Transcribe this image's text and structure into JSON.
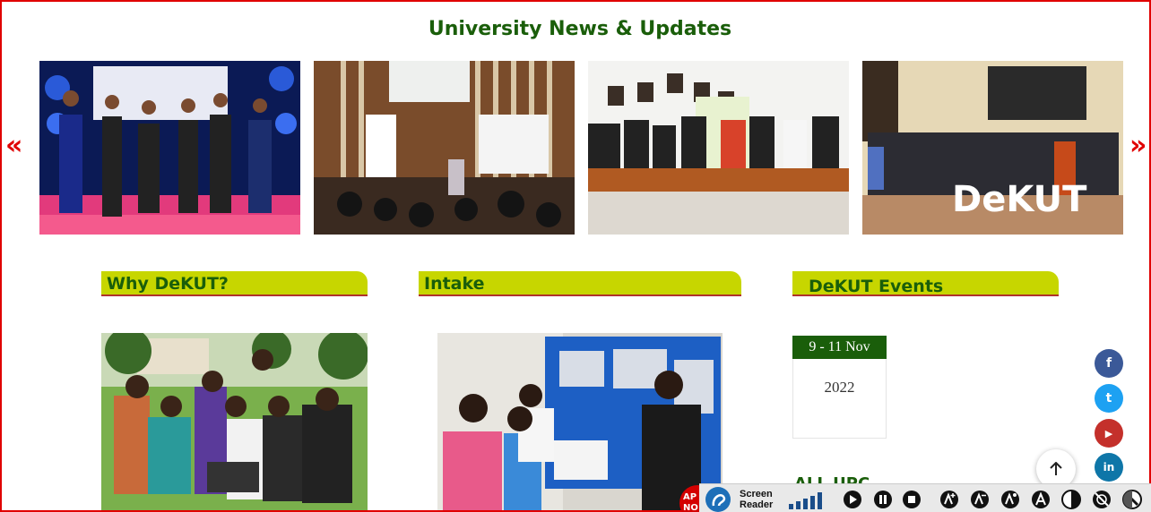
{
  "news": {
    "title": "University News & Updates",
    "prev_arrow": "«",
    "next_arrow": "»",
    "photos": [
      {
        "alt": "Group of delegates posing on stage at conference"
      },
      {
        "alt": "Lecture hall with presentation projected on screen"
      },
      {
        "alt": "Officials exchanging documents in boardroom"
      },
      {
        "alt": "Group photo in front of DeKUT sign",
        "sign_text": "DeKUT"
      }
    ]
  },
  "sections": {
    "why": {
      "title": "Why DeKUT?"
    },
    "intake": {
      "title": "Intake"
    },
    "events": {
      "title": "DeKUT Events"
    }
  },
  "event": {
    "date": "9 - 11 Nov",
    "year": "2022",
    "next_heading": "ALL UPC"
  },
  "social": [
    {
      "icon": "facebook-icon",
      "glyph": "f",
      "color": "#3b5998"
    },
    {
      "icon": "twitter-icon",
      "glyph": "t",
      "color": "#1da1f2"
    },
    {
      "icon": "youtube-icon",
      "glyph": "▶",
      "color": "#c4302b"
    },
    {
      "icon": "linkedin-icon",
      "glyph": "in",
      "color": "#0e76a8"
    }
  ],
  "apply": {
    "line1": "AP",
    "line2": "NO"
  },
  "toolbar": {
    "screen_reader_label_1": "Screen",
    "screen_reader_label_2": "Reader",
    "accent": "#1a5e0a"
  }
}
